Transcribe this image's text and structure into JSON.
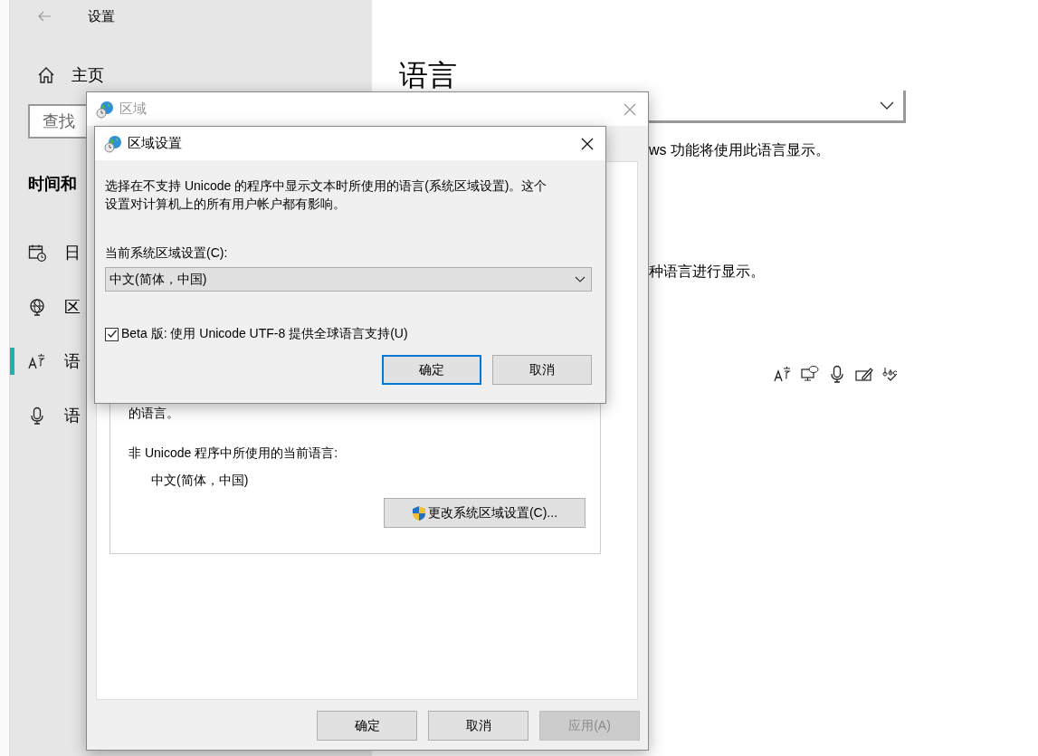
{
  "settings": {
    "title": "设置",
    "home": "主页",
    "search": {
      "placeholder": "查找"
    },
    "section": "时间和",
    "nav": [
      {
        "label": "日",
        "kind": "calendar",
        "selected": false
      },
      {
        "label": "区",
        "kind": "globe",
        "selected": false
      },
      {
        "label": "语",
        "kind": "language",
        "selected": true
      },
      {
        "label": "语",
        "kind": "microphone",
        "selected": false
      }
    ]
  },
  "page": {
    "heading": "语言",
    "lines": [
      "ws 功能将使用此语言显示。",
      "种语言进行显示。"
    ]
  },
  "region_window": {
    "title": "区域",
    "group_text_top": "的语言。",
    "current_label": "非 Unicode 程序中所使用的当前语言:",
    "current_value": "中文(简体，中国)",
    "change_button": "更改系统区域设置(C)...",
    "buttons": [
      {
        "label": "确定",
        "disabled": false
      },
      {
        "label": "取消",
        "disabled": false
      },
      {
        "label": "应用(A)",
        "disabled": true
      }
    ]
  },
  "region_dialog": {
    "title": "区域设置",
    "description": "选择在不支持 Unicode 的程序中显示文本时所使用的语言(系统区域设置)。这个设置对计算机上的所有用户帐户都有影响。",
    "locale_label": "当前系统区域设置(C):",
    "locale_value": "中文(简体，中国)",
    "beta": {
      "label": "Beta 版: 使用 Unicode UTF-8 提供全球语言支持(U)",
      "checked": true
    },
    "buttons": [
      {
        "label": "确定",
        "default": true
      },
      {
        "label": "取消",
        "default": false
      }
    ]
  }
}
